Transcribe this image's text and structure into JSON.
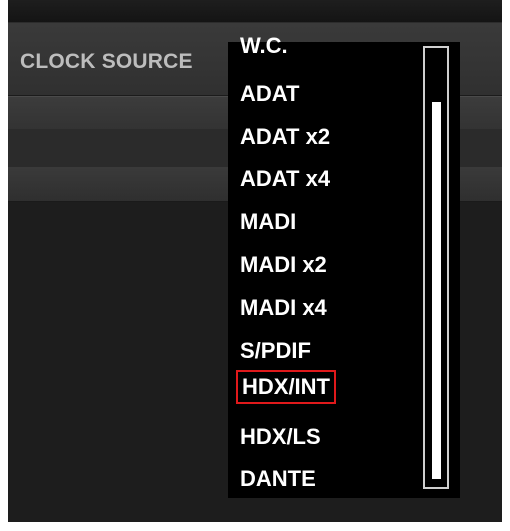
{
  "panel": {
    "clock_source_label": "CLOCK SOURCE"
  },
  "dropdown": {
    "selected_index": 8,
    "scroll_position_fraction": 0.12,
    "items": [
      {
        "label": "W.C."
      },
      {
        "label": "ADAT"
      },
      {
        "label": "ADAT x2"
      },
      {
        "label": "ADAT x4"
      },
      {
        "label": "MADI"
      },
      {
        "label": "MADI x2"
      },
      {
        "label": "MADI x4"
      },
      {
        "label": "S/PDIF"
      },
      {
        "label": "HDX/INT"
      },
      {
        "label": "HDX/LS"
      },
      {
        "label": "DANTE"
      }
    ]
  },
  "colors": {
    "selection_outline": "#e0191b",
    "dropdown_arrow": "#2e9bd6"
  }
}
